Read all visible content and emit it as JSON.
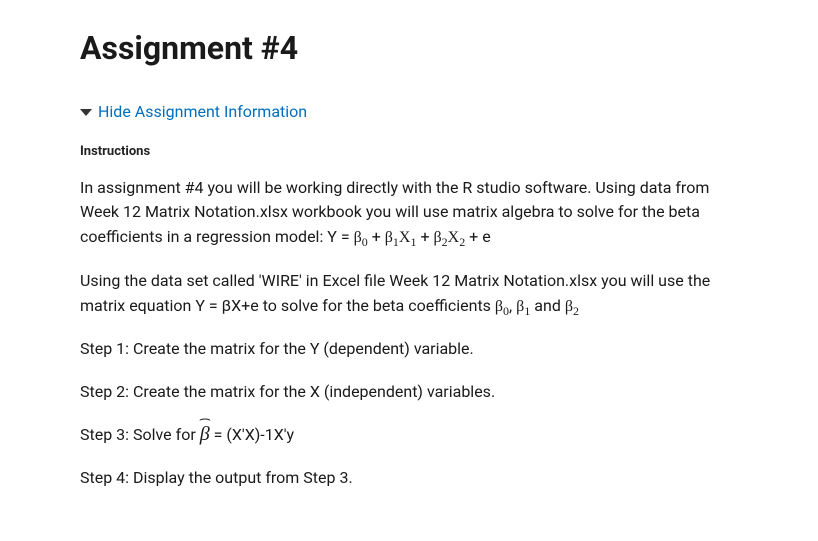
{
  "title": "Assignment #4",
  "toggle": {
    "label": "Hide Assignment Information"
  },
  "instructions_label": "Instructions",
  "p1": {
    "lead": "In assignment #4 you will be working directly with the R studio software. Using data from  Week 12 Matrix Notation.xlsx workbook you will use matrix algebra to solve for the beta coefficients in a regression model: Y = ",
    "b0": "β",
    "s0": "0",
    "plus1": " + ",
    "b1": "β",
    "s1": "1",
    "x1": "X",
    "xs1": "1",
    "plus2": " + ",
    "b2": "β",
    "s2": "2",
    "x2": "X",
    "xs2": "2",
    "tail": " + e"
  },
  "p2": {
    "lead": "Using the data set called 'WIRE' in Excel file Week 12 Matrix Notation.xlsx you will use the matrix equation Y = βX+e to solve for the beta coefficients ",
    "b0": "β",
    "s0": "0",
    "comma": ", ",
    "b1": "β",
    "s1": "1",
    "and": " and ",
    "b2": "β",
    "s2": "2"
  },
  "step1": "Step 1:  Create the matrix for the Y (dependent) variable.",
  "step2": "Step 2:  Create the matrix for the X (independent) variables.",
  "step3": {
    "lead": "Step 3:  Solve for ",
    "beta": "β",
    "tail": " = (X'X)-1X'y"
  },
  "step4": "Step 4: Display the output from Step 3."
}
